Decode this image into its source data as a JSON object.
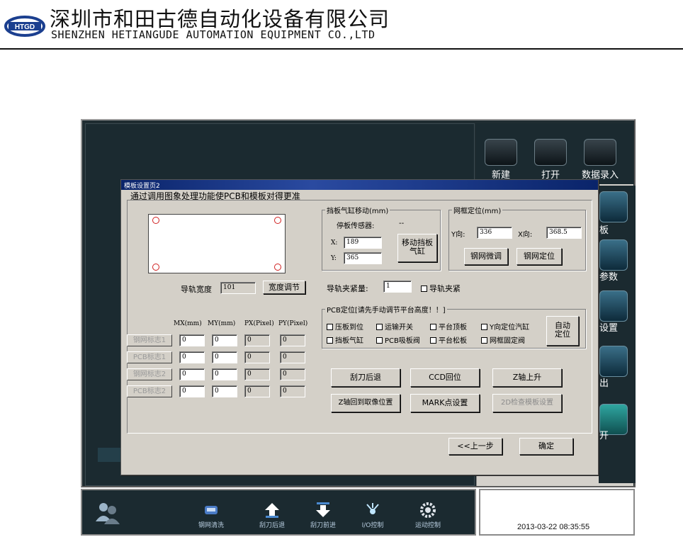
{
  "header": {
    "logo_text": "HTGD",
    "company_cn": "深圳市和田古德自动化设备有限公司",
    "company_en": "SHENZHEN HETIANGUDE AUTOMATION EQUIPMENT CO.,LTD"
  },
  "right_menu": [
    {
      "label": "新建",
      "icon": "folder-icon"
    },
    {
      "label": "打开",
      "icon": "open-book-icon"
    },
    {
      "label": "数据录入",
      "icon": "data-entry-icon"
    }
  ],
  "right_side_labels": [
    "板",
    "参数",
    "设置",
    "出",
    "开"
  ],
  "dialog": {
    "title": "模板设置页2",
    "subtitle": "通过调用图象处理功能使PCB和模板对得更准",
    "rail_width_label": "导轨宽度",
    "rail_width_value": "101",
    "width_adjust_button": "宽度调节",
    "table_headers": [
      "MX(mm)",
      "MY(mm)",
      "PX(Pixel)",
      "PY(Pixel)"
    ],
    "marks": [
      {
        "label": "钢网标志1",
        "mx": "0",
        "my": "0",
        "px": "0",
        "py": "0"
      },
      {
        "label": "PCB标志1",
        "mx": "0",
        "my": "0",
        "px": "0",
        "py": "0"
      },
      {
        "label": "钢网标志2",
        "mx": "0",
        "my": "0",
        "px": "0",
        "py": "0"
      },
      {
        "label": "PCB标志2",
        "mx": "0",
        "my": "0",
        "px": "0",
        "py": "0"
      }
    ],
    "stop_cylinder": {
      "title": "挡板气缸移动(mm)",
      "sensor_label": "停板传感器:",
      "sensor_value": "--",
      "x_label": "X:",
      "x_value": "189",
      "y_label": "Y:",
      "y_value": "365",
      "move_button_line1": "移动挡板",
      "move_button_line2": "气缸"
    },
    "frame_position": {
      "title": "网框定位(mm)",
      "y_label": "Y向:",
      "y_value": "336",
      "x_label": "X向:",
      "x_value": "368.5",
      "fine_tune_button": "钢网微调",
      "locate_button": "钢网定位"
    },
    "rail_clamp_label": "导轨夹紧量:",
    "rail_clamp_value": "1",
    "rail_clamp_checkbox": "导轨夹紧",
    "pcb_position": {
      "title": "PCB定位[请先手动调节平台高度！！]",
      "checkboxes_row1": [
        "压板到位",
        "运输开关",
        "平台顶板",
        "Y向定位汽缸"
      ],
      "checkboxes_row2": [
        "挡板气缸",
        "PCB吸板阀",
        "平台松板",
        "网框固定阀"
      ],
      "auto_button_line1": "自动",
      "auto_button_line2": "定位"
    },
    "action_buttons": [
      {
        "label": "刮刀后退",
        "enabled": true
      },
      {
        "label": "CCD回位",
        "enabled": true
      },
      {
        "label": "Z轴上升",
        "enabled": true
      },
      {
        "label": "Z轴回到取像位置",
        "enabled": true
      },
      {
        "label": "MARK点设置",
        "enabled": true
      },
      {
        "label": "2D检查模板设置",
        "enabled": false
      }
    ],
    "prev_button": "<<上一步",
    "ok_button": "确定"
  },
  "bottom_bar": [
    {
      "label": "钢网清洗",
      "icon": "wash-icon"
    },
    {
      "label": "刮刀后退",
      "icon": "arrow-up-icon"
    },
    {
      "label": "刮刀前进",
      "icon": "arrow-down-icon"
    },
    {
      "label": "I/O控制",
      "icon": "io-control-icon"
    },
    {
      "label": "运动控制",
      "icon": "gear-icon"
    }
  ],
  "datetime": "2013-03-22  08:35:55",
  "colors": {
    "screen_bg": "#1f2c31",
    "dialog_bg": "#d4d0c8",
    "title_bar": "#0a246a",
    "bottom_label": "#b8cde0"
  }
}
